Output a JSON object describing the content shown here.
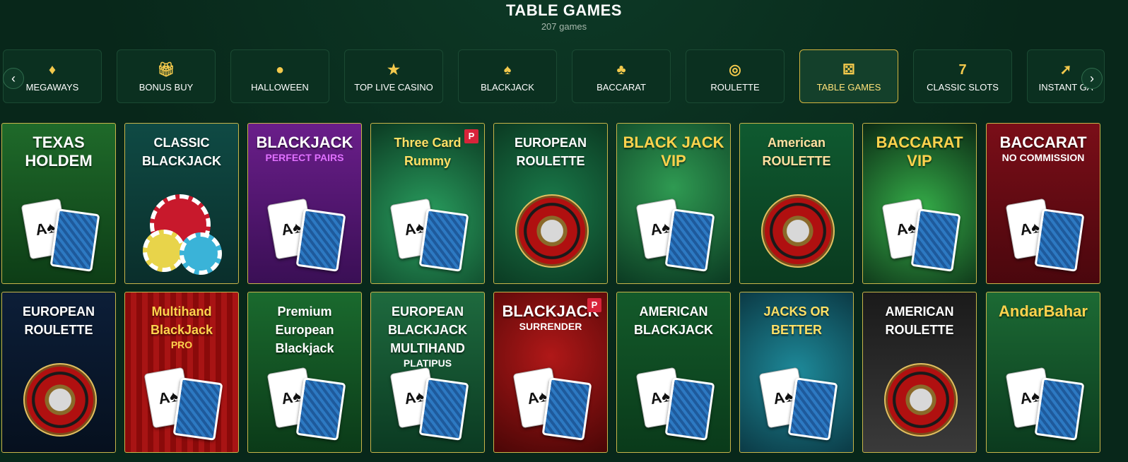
{
  "header": {
    "title": "TABLE GAMES",
    "count": "207 games"
  },
  "categories": [
    {
      "label": "MEGAWAYS",
      "icon": "diamond-icon",
      "glyph": "♦",
      "active": false
    },
    {
      "label": "BONUS BUY",
      "icon": "gift-icon",
      "glyph": "🎁︎",
      "active": false
    },
    {
      "label": "HALLOWEEN",
      "icon": "pumpkin-icon",
      "glyph": "●",
      "active": false
    },
    {
      "label": "TOP LIVE CASINO",
      "icon": "top-badge-icon",
      "glyph": "★",
      "active": false
    },
    {
      "label": "BLACKJACK",
      "icon": "blackjack-21-icon",
      "glyph": "♠",
      "active": false
    },
    {
      "label": "BACCARAT",
      "icon": "cards-icon",
      "glyph": "♣",
      "active": false
    },
    {
      "label": "ROULETTE",
      "icon": "roulette-icon",
      "glyph": "◎",
      "active": false
    },
    {
      "label": "TABLE GAMES",
      "icon": "dice-icon",
      "glyph": "⚄",
      "active": true
    },
    {
      "label": "CLASSIC SLOTS",
      "icon": "seven-icon",
      "glyph": "7",
      "active": false
    },
    {
      "label": "INSTANT GA",
      "icon": "rocket-icon",
      "glyph": "➚",
      "active": false
    }
  ],
  "nav": {
    "prev": "‹",
    "next": "›"
  },
  "games": [
    {
      "title": "TEXAS HOLDEM",
      "subtitle": "",
      "theme": "texas"
    },
    {
      "title": "CLASSIC BLACKJACK",
      "subtitle": "",
      "theme": "classic-bj"
    },
    {
      "title": "BLACKJACK",
      "subtitle": "PERFECT PAIRS",
      "theme": "perfect-pairs"
    },
    {
      "title": "Three Card Rummy",
      "subtitle": "",
      "theme": "rummy",
      "badge": "P"
    },
    {
      "title": "EUROPEAN ROULETTE",
      "subtitle": "",
      "theme": "euro-roulette-1"
    },
    {
      "title": "BLACK JACK VIP",
      "subtitle": "",
      "theme": "bj-vip"
    },
    {
      "title": "American ROULETTE",
      "subtitle": "",
      "theme": "am-roulette-1"
    },
    {
      "title": "BACCARAT VIP",
      "subtitle": "",
      "theme": "baccarat-vip"
    },
    {
      "title": "BACCARAT",
      "subtitle": "NO COMMISSION",
      "theme": "baccarat-nc"
    },
    {
      "title": "EUROPEAN ROULETTE",
      "subtitle": "",
      "theme": "euro-roulette-2"
    },
    {
      "title": "Multihand BlackJack",
      "subtitle": "PRO",
      "theme": "multihand-pro"
    },
    {
      "title": "Premium European Blackjack",
      "subtitle": "",
      "theme": "premium-euro"
    },
    {
      "title": "EUROPEAN BLACKJACK MULTIHAND",
      "subtitle": "PLATIPUS",
      "theme": "euro-bj-multi"
    },
    {
      "title": "BLACKJACK",
      "subtitle": "SURRENDER",
      "theme": "bj-surrender",
      "badge": "P"
    },
    {
      "title": "AMERICAN BLACKJACK",
      "subtitle": "",
      "theme": "am-bj"
    },
    {
      "title": "JACKS OR BETTER",
      "subtitle": "",
      "theme": "jacks"
    },
    {
      "title": "AMERICAN ROULETTE",
      "subtitle": "",
      "theme": "am-roulette-2"
    },
    {
      "title": "AndarBahar",
      "subtitle": "",
      "theme": "andar"
    }
  ],
  "colors": {
    "accent": "#d4b53f",
    "bg": "#08271a"
  }
}
